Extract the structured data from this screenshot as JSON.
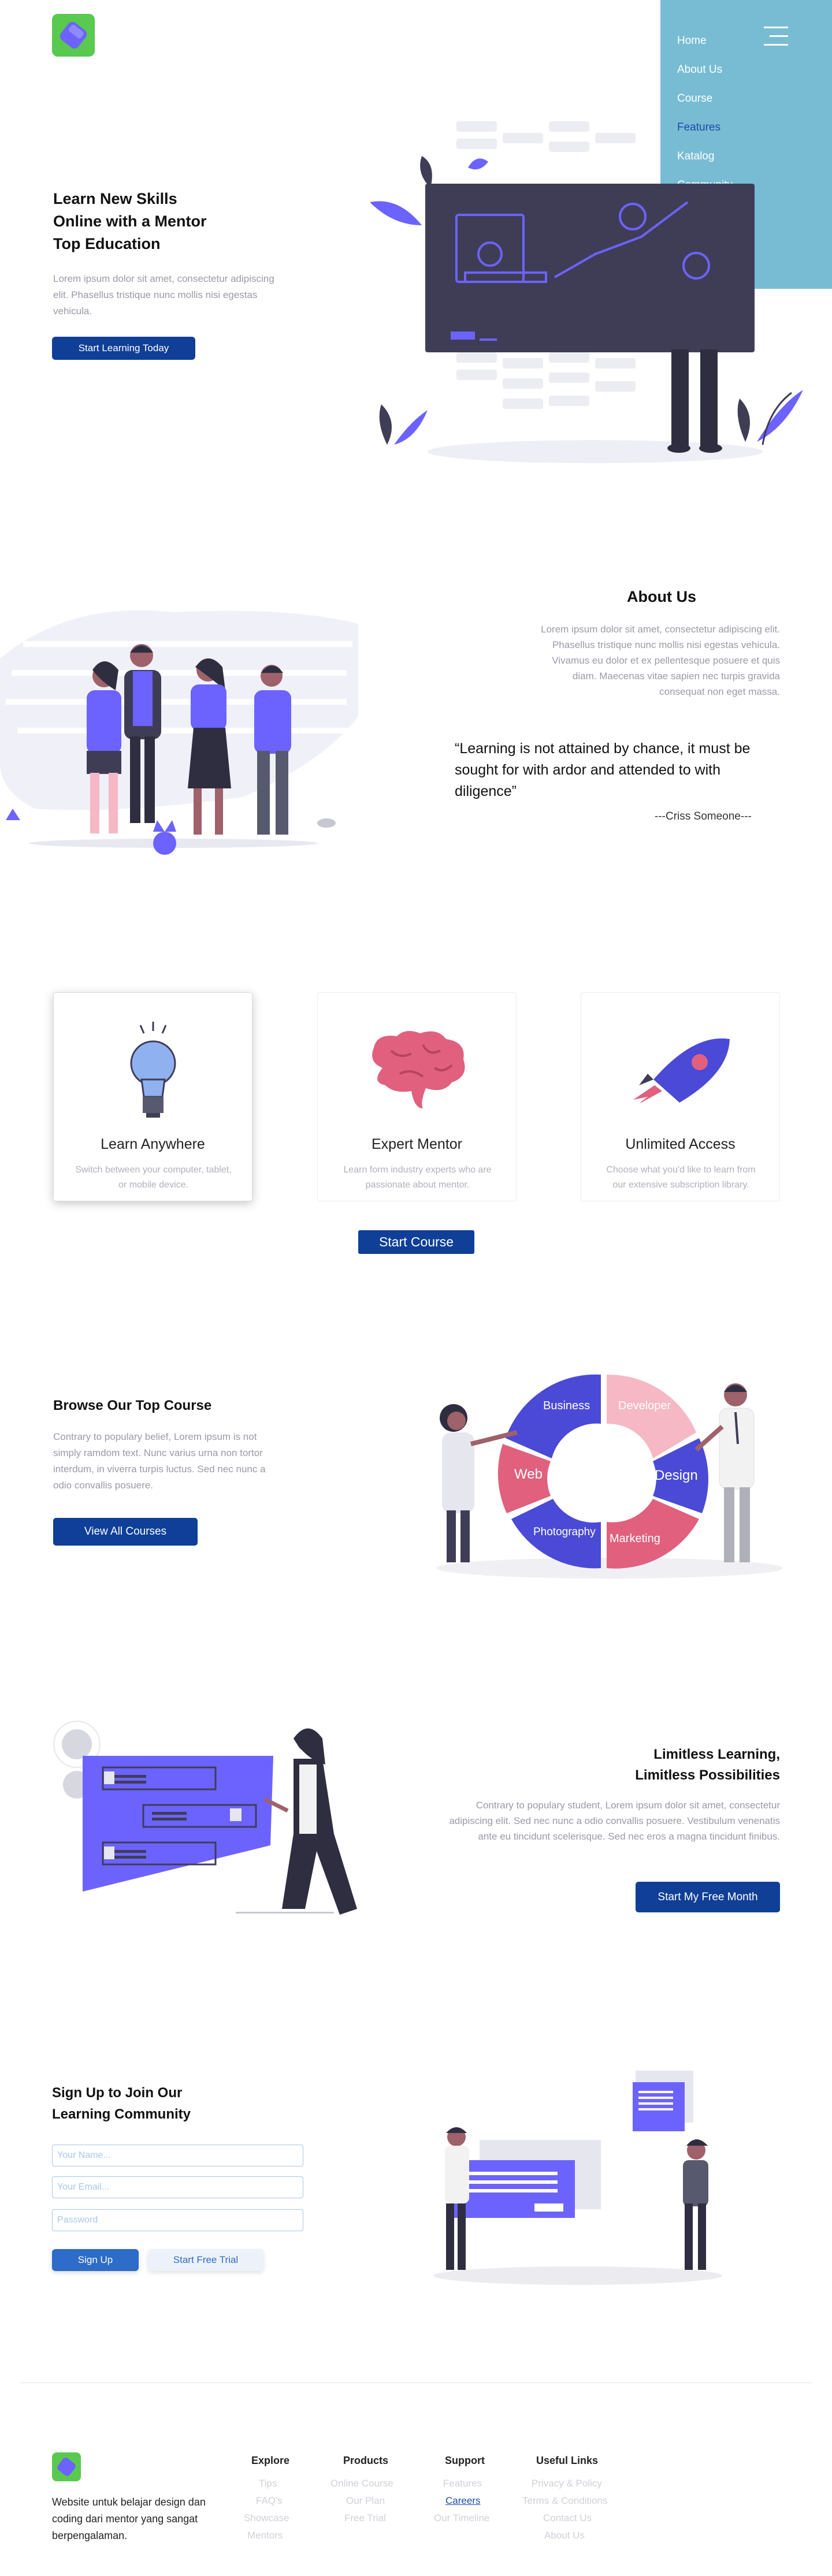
{
  "nav": {
    "items": [
      {
        "label": "Home",
        "active": false
      },
      {
        "label": "About Us",
        "active": false
      },
      {
        "label": "Course",
        "active": false
      },
      {
        "label": "Features",
        "active": true
      },
      {
        "label": "Katalog",
        "active": false
      },
      {
        "label": "Community",
        "active": false
      }
    ]
  },
  "hero": {
    "title_line1": "Learn New Skills",
    "title_line2": "Online with a Mentor",
    "title_line3": "Top Education",
    "desc": "Lorem ipsum dolor sit amet, consectetur adipiscing elit. Phasellus tristique nunc mollis nisi egestas vehicula.",
    "cta": "Start Learning Today"
  },
  "about": {
    "title": "About Us",
    "desc": "Lorem ipsum dolor sit amet, consectetur adipiscing elit. Phasellus tristique nunc mollis nisi egestas vehicula. Vivamus eu dolor et ex pellentesque posuere et quis diam. Maecenas vitae sapien nec turpis gravida consequat non eget massa.",
    "quote": "“Learning is not attained by chance, it must be sought for with ardor and attended to with diligence”",
    "author": "---Criss Someone---"
  },
  "features": {
    "cards": [
      {
        "title": "Learn Anywhere",
        "desc": "Switch between your computer, tablet, or mobile device."
      },
      {
        "title": "Expert Mentor",
        "desc": "Learn form industry experts who are passionate about mentor."
      },
      {
        "title": "Unlimited Access",
        "desc": "Choose what you'd like to learn from our extensive subscription library."
      }
    ],
    "cta": "Start Course"
  },
  "browse": {
    "title": "Browse Our Top Course",
    "desc": "Contrary to populary belief, Lorem ipsum is not simply ramdom text. Nunc varius urna non tortor interdum, in viverra turpis luctus. Sed nec nunc a odio convallis posuere.",
    "cta": "View All Courses",
    "puzzle": [
      "Business",
      "Developer",
      "Design",
      "Marketing",
      "Photography",
      "Web"
    ]
  },
  "limitless": {
    "title_line1": "Limitless Learning,",
    "title_line2": "Limitless Possibilities",
    "desc": "Contrary to populary student, Lorem ipsum dolor sit amet, consectetur adipiscing elit. Sed nec nunc a odio convallis posuere. Vestibulum venenatis ante eu tincidunt scelerisque. Sed nec eros a magna tincidunt finibus.",
    "cta": "Start My Free Month"
  },
  "signup": {
    "title_line1": "Sign Up to Join Our",
    "title_line2": "Learning Community",
    "name_placeholder": "Your Name...",
    "email_placeholder": "Your Email...",
    "password_placeholder": "Password",
    "signup_label": "Sign Up",
    "trial_label": "Start Free Trial"
  },
  "footer": {
    "tagline": "Website untuk belajar design dan coding dari mentor yang sangat berpengalaman.",
    "columns": [
      {
        "title": "Explore",
        "links": [
          {
            "label": "Tips",
            "active": false
          },
          {
            "label": "FAQ's",
            "active": false
          },
          {
            "label": "Showcase",
            "active": false
          },
          {
            "label": "Mentors",
            "active": false
          }
        ]
      },
      {
        "title": "Products",
        "links": [
          {
            "label": "Online Course",
            "active": false
          },
          {
            "label": "Our Plan",
            "active": false
          },
          {
            "label": "Free Trial",
            "active": false
          }
        ]
      },
      {
        "title": "Support",
        "links": [
          {
            "label": "Features",
            "active": false
          },
          {
            "label": "Careers",
            "active": true
          },
          {
            "label": "Our Timeline",
            "active": false
          }
        ]
      },
      {
        "title": "Useful Links",
        "links": [
          {
            "label": "Privacy & Policy",
            "active": false
          },
          {
            "label": "Terms & Conditions",
            "active": false
          },
          {
            "label": "Contact Us",
            "active": false
          },
          {
            "label": "About Us",
            "active": false
          }
        ]
      }
    ]
  },
  "colors": {
    "primary": "#0f3f96",
    "accent_purple": "#6c63ff",
    "nav_bg": "#78bcd3",
    "pink": "#e0607e"
  }
}
